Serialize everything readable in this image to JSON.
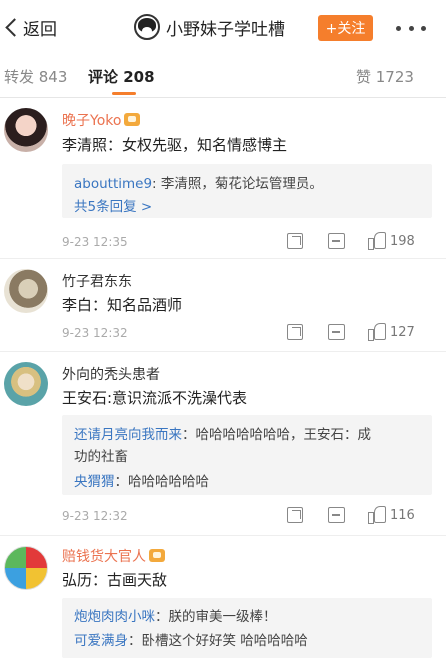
{
  "header": {
    "back_label": "返回",
    "title": "小野妹子学吐槽",
    "follow_label": "+关注"
  },
  "tabs": {
    "repost": "转发 843",
    "comment": "评论 208",
    "like": "赞 1723"
  },
  "comments": [
    {
      "username": "晚子Yoko",
      "text": "李清照：女权先驱，知名情感博主",
      "replies": [
        {
          "name": "abouttime9",
          "text": ": 李清照，菊花论坛管理员。"
        }
      ],
      "more_replies": "共5条回复 >",
      "time": "9-23 12:35",
      "likes": "198"
    },
    {
      "username": "竹子君东东",
      "text": "李白：知名品酒师",
      "replies": [],
      "time": "9-23 12:32",
      "likes": "127"
    },
    {
      "username": "外向的秃头患者",
      "text": "王安石:意识流派不洗澡代表",
      "replies": [
        {
          "name": "还请月亮向我而来",
          "text": "：哈哈哈哈哈哈哈，王安石：成",
          "text2": "功的社畜"
        },
        {
          "name": "央猬猬",
          "text": "：哈哈哈哈哈哈"
        }
      ],
      "time": "9-23 12:32",
      "likes": "116"
    },
    {
      "username": "赔钱货大官人",
      "text": "弘历：古画天敌",
      "replies": [
        {
          "name": "炮炮肉肉小咪",
          "text": "：朕的审美一级棒！"
        },
        {
          "name": "可爱满身",
          "text": "：卧槽这个好好笑 哈哈哈哈哈"
        }
      ]
    }
  ],
  "colors": {
    "accent": "#f57e2c",
    "link": "#3a76c1",
    "vip_name": "#eb7350"
  }
}
